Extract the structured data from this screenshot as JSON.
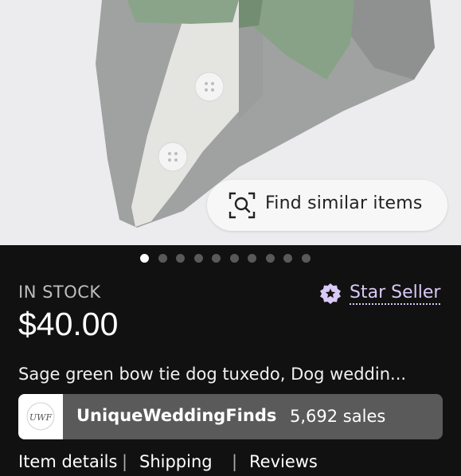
{
  "find_similar": {
    "label": "Find similar items",
    "icon": "visual-search-icon"
  },
  "carousel": {
    "total": 10,
    "active_index": 0
  },
  "stock_label": "IN STOCK",
  "star_seller": {
    "label": "Star Seller",
    "icon": "star-badge-icon",
    "color": "#d9c9f6"
  },
  "price": "$40.00",
  "title": "Sage green bow tie dog tuxedo, Dog weddin...",
  "shop": {
    "logo_text": "UWF",
    "name": "UniqueWeddingFinds",
    "sales": "5,692 sales"
  },
  "tabs": [
    "Item details",
    "Shipping",
    "Reviews"
  ],
  "colors": {
    "background": "#111111",
    "shop_bar": "#5a5a5a",
    "sage_green": "#8aa48a",
    "gray_fabric": "#9c9e9d"
  }
}
